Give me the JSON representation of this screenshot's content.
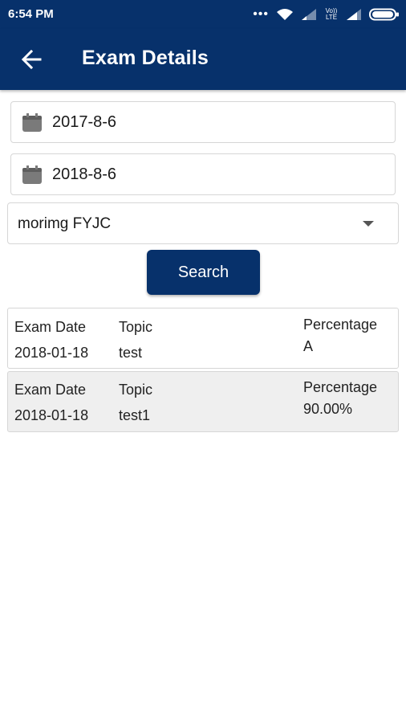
{
  "status_bar": {
    "time": "6:54 PM",
    "network_label": "Vo)) LTE"
  },
  "app_bar": {
    "title": "Exam Details",
    "back_icon": "arrow-left-icon"
  },
  "filters": {
    "from_date": "2017-8-6",
    "to_date": "2018-8-6",
    "class_select": "morimg FYJC",
    "calendar_icon": "calendar-icon",
    "search_label": "Search"
  },
  "results": [
    {
      "date_label": "Exam Date",
      "date": "2018-01-18",
      "topic_label": "Topic",
      "topic": "test",
      "pct_label": "Percentage",
      "pct": "A"
    },
    {
      "date_label": "Exam Date",
      "date": "2018-01-18",
      "topic_label": "Topic",
      "topic": "test1",
      "pct_label": "Percentage",
      "pct": "90.00%"
    }
  ],
  "colors": {
    "primary": "#07316b",
    "alt_row": "#efefef"
  }
}
